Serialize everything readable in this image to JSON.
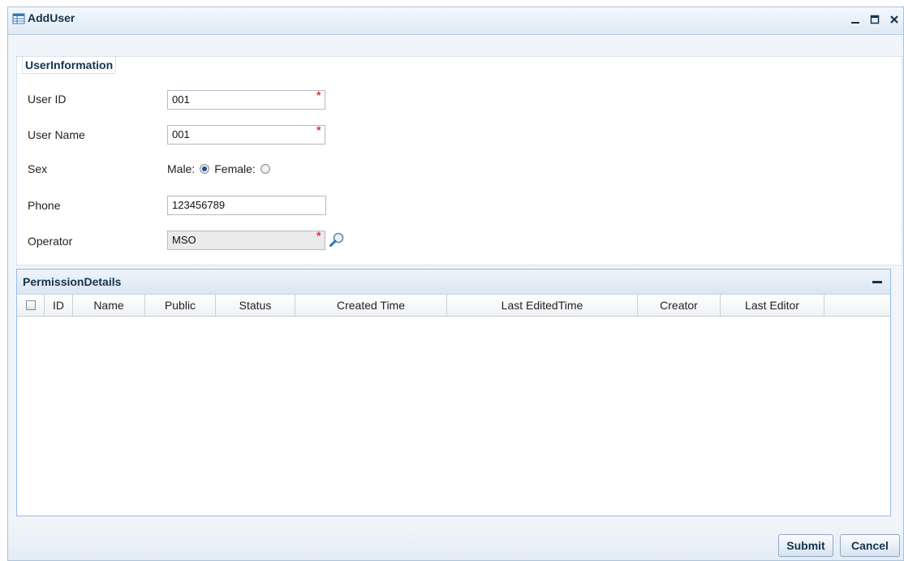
{
  "window": {
    "title": "AddUser",
    "icon": "grid-icon",
    "tools": [
      "minimize-icon",
      "maximize-icon",
      "close-icon"
    ]
  },
  "user_information": {
    "legend": "UserInformation",
    "fields": {
      "user_id": {
        "label": "User ID",
        "value": "001",
        "required": true
      },
      "user_name": {
        "label": "User Name",
        "value": "001",
        "required": true
      },
      "sex": {
        "label": "Sex",
        "options": [
          "Male:",
          "Female:"
        ],
        "selected": "Male:"
      },
      "phone": {
        "label": "Phone",
        "value": "123456789"
      },
      "operator": {
        "label": "Operator",
        "value": "MSO",
        "required": true,
        "readonly": true
      }
    },
    "required_mark": "*"
  },
  "permission_details": {
    "title": "PermissionDetails",
    "columns": [
      "ID",
      "Name",
      "Public",
      "Status",
      "Created Time",
      "Last EditedTime",
      "Creator",
      "Last Editor"
    ],
    "rows": []
  },
  "footer": {
    "submit_label": "Submit",
    "cancel_label": "Cancel"
  },
  "colors": {
    "accent": "#15334d",
    "required": "#e03333",
    "border": "#99bbe8"
  }
}
